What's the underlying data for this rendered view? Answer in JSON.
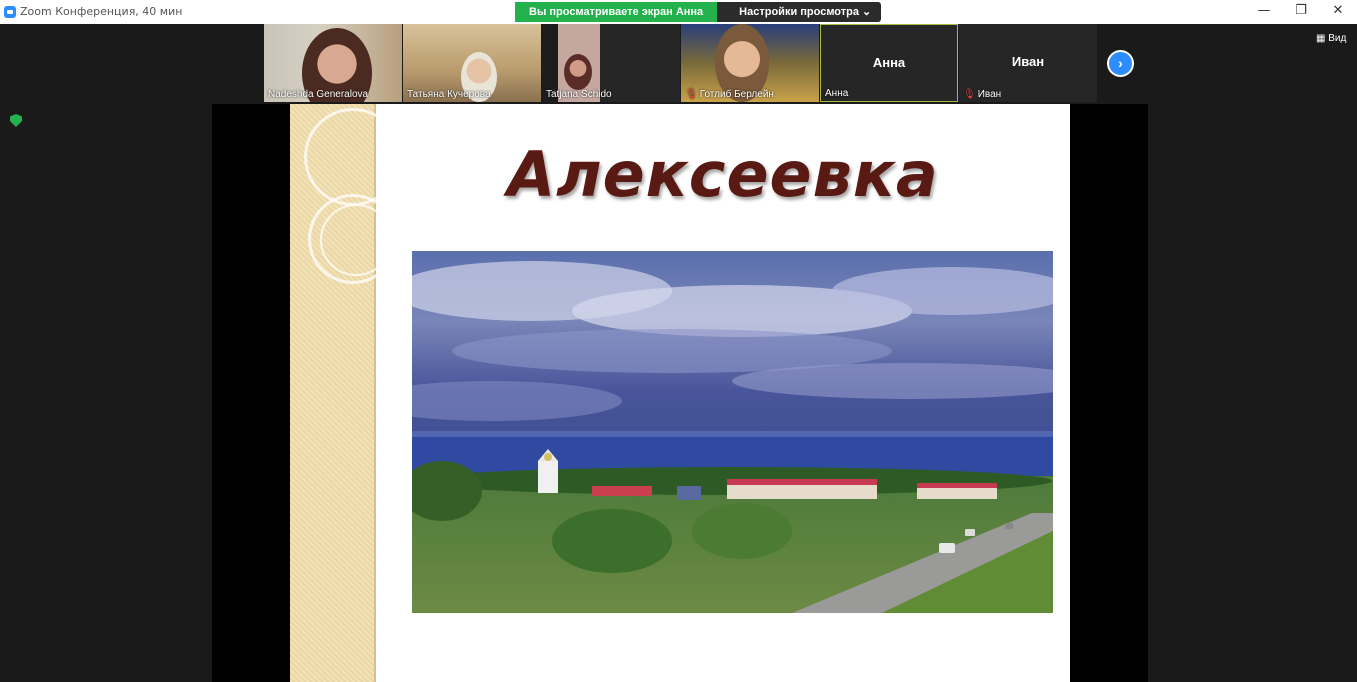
{
  "window": {
    "title": "Zoom Конференция, 40 мин",
    "minimize_glyph": "—",
    "maximize_glyph": "❐",
    "close_glyph": "✕"
  },
  "share_banner": {
    "status": "Вы просматриваете экран Анна",
    "settings": "Настройки просмотра ⌄"
  },
  "participants": [
    {
      "name": "Nadeshda Generalova",
      "muted": false
    },
    {
      "name": "Татьяна Кучерова",
      "muted": false
    },
    {
      "name": "Tatjana Schido",
      "muted": false
    },
    {
      "name": "Готлиб Берлейн",
      "muted": true
    },
    {
      "name": "Анна",
      "big_name": "Анна",
      "muted": false,
      "active": true
    },
    {
      "name": "Иван",
      "big_name": "Иван",
      "muted": true
    }
  ],
  "view_button": "Вид",
  "next_glyph": "›",
  "slide": {
    "title": "Алексеевка"
  },
  "colors": {
    "share_green": "#23b14d",
    "accent_blue": "#2d8cff",
    "title_brown": "#5a1a14"
  }
}
